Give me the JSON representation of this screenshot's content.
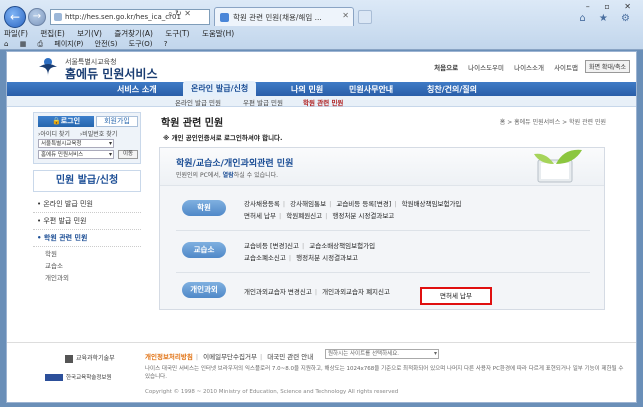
{
  "browser": {
    "address": "http://hes.sen.go.kr/hes_ica_cr01",
    "tab_title": "학원 관련 민원(채용/해임 ...",
    "menu": [
      "파일(F)",
      "편집(E)",
      "보기(V)",
      "즐겨찾기(A)",
      "도구(T)",
      "도움말(H)"
    ],
    "toolbar": [
      "페이지(P)",
      "안전(S)",
      "도구(O)"
    ],
    "window_controls": "– ▫ ✕",
    "chrome_icons": "⌂ ★ ⚙"
  },
  "header": {
    "logo_small": "서울특별시교육청",
    "logo_big": "홈에듀 민원서비스",
    "toplinks": [
      "처음으로",
      "나이스도우미",
      "나이스소개",
      "사이트맵"
    ],
    "screen_size": "화면 확대/축소"
  },
  "gnb": [
    "서비스 소개",
    "온라인 발급/신청",
    "나의 민원",
    "민원사무안내",
    "칭찬/건의/질의"
  ],
  "sub_gnb": [
    "온라인 발급 민원",
    "우편 발급 민원",
    "학원 관련 민원"
  ],
  "login": {
    "login_label": "로그인",
    "join_label": "회원가입",
    "find_id": "아이디 찾기",
    "find_pw": "비밀번호 찾기",
    "select1": "서울특별시교육청",
    "select2": "홈에듀 민원서비스",
    "move": "이동"
  },
  "left": {
    "title": "민원 발급/신청",
    "items": [
      "온라인 발급 민원",
      "우편 발급 민원",
      "학원 관련 민원"
    ],
    "subs": [
      "학원",
      "교습소",
      "개인과외"
    ]
  },
  "main": {
    "breadcrumb": "홈 > 홈에듀 민원서비스 > 학원 관련 민원",
    "title": "학원 관련 민원",
    "notice": "※ 개인 공인인증서로 로그인하셔야 합니다.",
    "banner_title": "학원/교습소/개인과외관련 민원",
    "banner_desc_pre": "민원인의 PC에서, ",
    "banner_desc_bold": "열람",
    "banner_desc_post": "하실 수 있습니다."
  },
  "categories": [
    {
      "label": "학원",
      "rows": [
        [
          "강사채용등록",
          "강사해임통보",
          "교습비등 등록[변경]",
          "학원배상책임보험가입"
        ],
        [
          "면허세 납부",
          "학원폐원신고",
          "행정처분 시정결과보고"
        ]
      ]
    },
    {
      "label": "교습소",
      "rows": [
        [
          "교습비등 [변경]신고",
          "교습소배상책임보험가입"
        ],
        [
          "교습소폐소신고",
          "행정처분 시정결과보고"
        ]
      ],
      "highlight": "면허세 납부"
    },
    {
      "label": "개인과외",
      "rows": [
        [
          "개인과외교습자 변경신고",
          "개인과외교습자 폐지신고"
        ]
      ]
    }
  ],
  "footer": {
    "logo1": "교육과학기술부",
    "logo2": "한국교육학술정보원",
    "privacy": "개인정보처리방침",
    "email_policy": "이메일무단수집거부",
    "site_label": "대국민 관련 안내",
    "select": "원하시는 사이트를 선택하세요.",
    "text": "나이스 대국민 서비스는 인터넷 브라우저의 익스플로러 7.0~8.0을 지원하고, 해상도는 1024x768을 기준으로 최적화되어 있으며 나머지 다른 사용자 PC환경에 따라 다르게 표현되거나 일부 기능이 제한될 수 있습니다.",
    "copyright": "Copyright © 1998 ~ 2010 Ministry of Education, Science and Technology All rights reserved"
  }
}
